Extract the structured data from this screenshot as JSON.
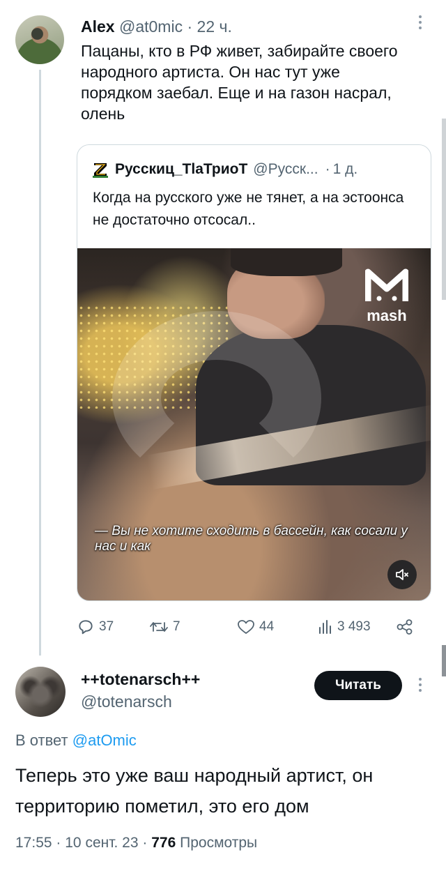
{
  "tweet1": {
    "author_name": "Alex",
    "handle": "@at0mic",
    "separator": "·",
    "time": "22 ч.",
    "text": "Пацаны, кто в РФ живет, забирайте своего народного артиста. Он нас тут уже порядком заебал. Еще и на газон насрал, олень",
    "quote": {
      "author_name": "Русскиц_ТlaТриоТ",
      "handle": "@Русск...",
      "separator": "·",
      "time": "1 д.",
      "text": "Когда на русского уже не тянет, а на эстоонса не достаточно отсосал..",
      "video": {
        "logo_text": "mash",
        "subtitle": "— Вы не хотите сходить в бассейн, как сосали у нас и как",
        "muted": true
      }
    },
    "actions": {
      "replies": "37",
      "retweets": "7",
      "likes": "44",
      "views": "3 493"
    }
  },
  "tweet2": {
    "author_name": "++totenarsch++",
    "handle": "@totenarsch",
    "follow_label": "Читать",
    "reply_prefix": "В ответ",
    "reply_mention": "@atOmic",
    "text": "Теперь это уже ваш народный артист, он территорию пометил, это его дом",
    "time": "17:55",
    "separator1": "·",
    "date": "10 сент. 23",
    "separator2": "·",
    "views_count": "776",
    "views_label": "Просмотры"
  },
  "colors": {
    "text_primary": "#0f1419",
    "text_secondary": "#536471",
    "link": "#1d9bf0",
    "border": "#cfd9de"
  }
}
